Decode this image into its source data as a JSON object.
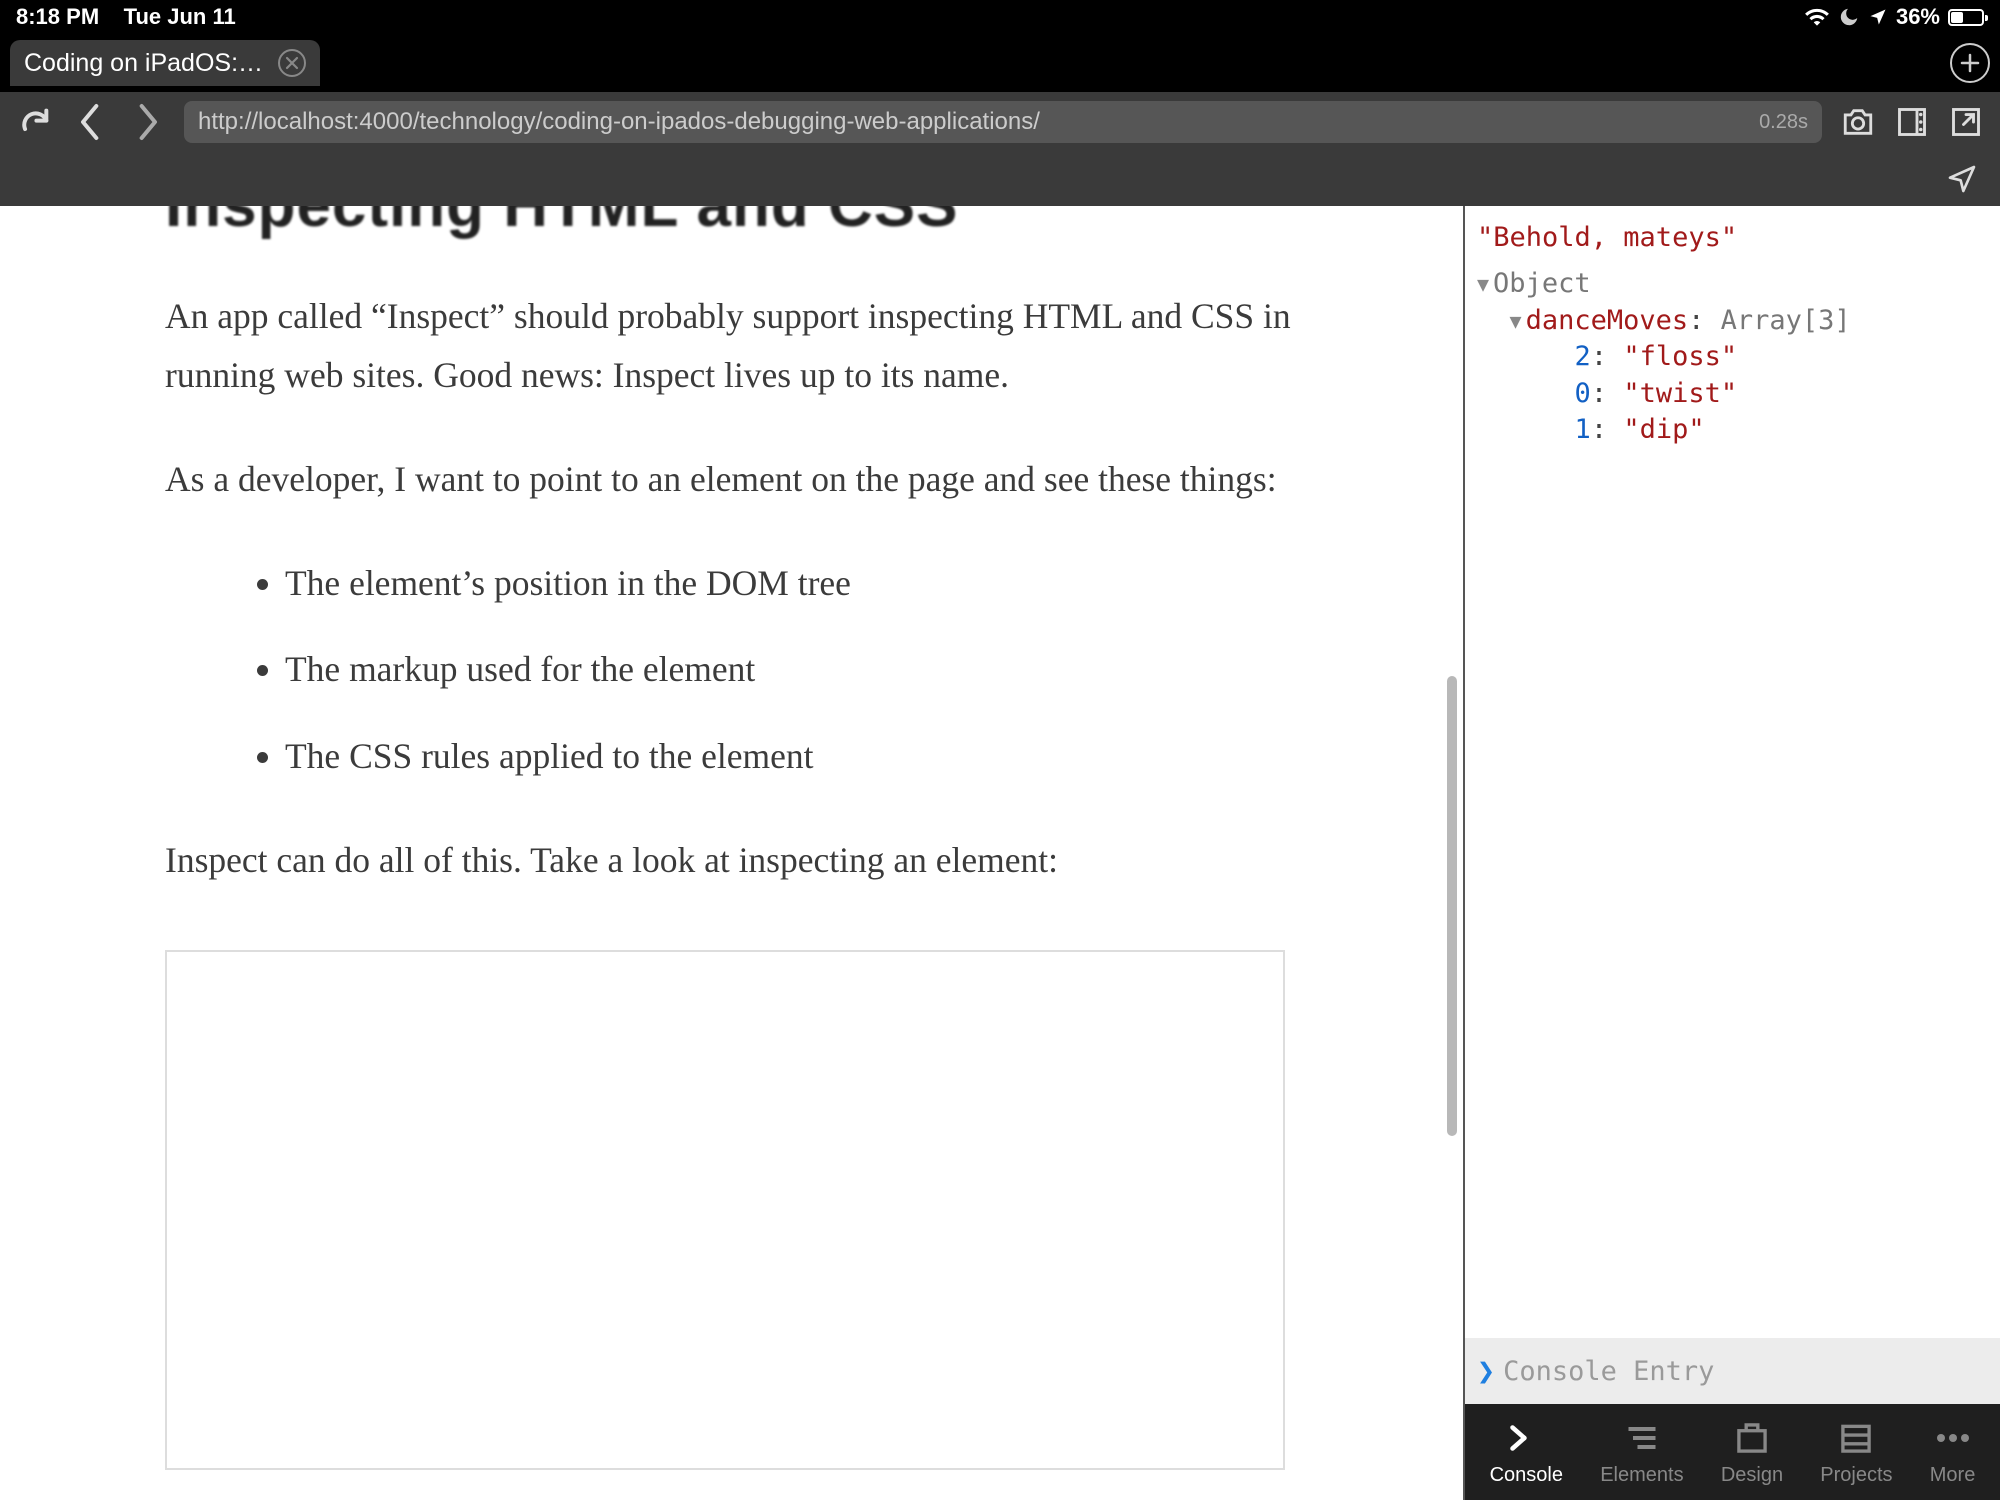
{
  "status": {
    "time": "8:18 PM",
    "date": "Tue Jun 11",
    "battery_pct": "36%"
  },
  "tabs": {
    "active_title": "Coding on iPadOS: D…"
  },
  "urlbar": {
    "url": "http://localhost:4000/technology/coding-on-ipados-debugging-web-applications/",
    "load_time": "0.28s"
  },
  "article": {
    "heading_peek": "Inspecting HTML and CSS",
    "p1": "An app called “Inspect” should probably support inspecting HTML and CSS in running web sites. Good news: Inspect lives up to its name.",
    "p2": "As a developer, I want to point to an element on the page and see these things:",
    "bullets": [
      "The element’s position in the DOM tree",
      "The markup used for the element",
      "The CSS rules applied to the element"
    ],
    "p3": "Inspect can do all of this. Take a look at inspecting an element:"
  },
  "console": {
    "line1": "\"Behold, mateys\"",
    "object_label": "Object",
    "prop_name": "danceMoves",
    "array_label": "Array",
    "array_len": "[3]",
    "entries": [
      {
        "idx": "2",
        "val": "\"floss\""
      },
      {
        "idx": "0",
        "val": "\"twist\""
      },
      {
        "idx": "1",
        "val": "\"dip\""
      }
    ],
    "input_placeholder": "Console Entry"
  },
  "devtabs": {
    "console": "Console",
    "elements": "Elements",
    "design": "Design",
    "projects": "Projects",
    "more": "More"
  }
}
